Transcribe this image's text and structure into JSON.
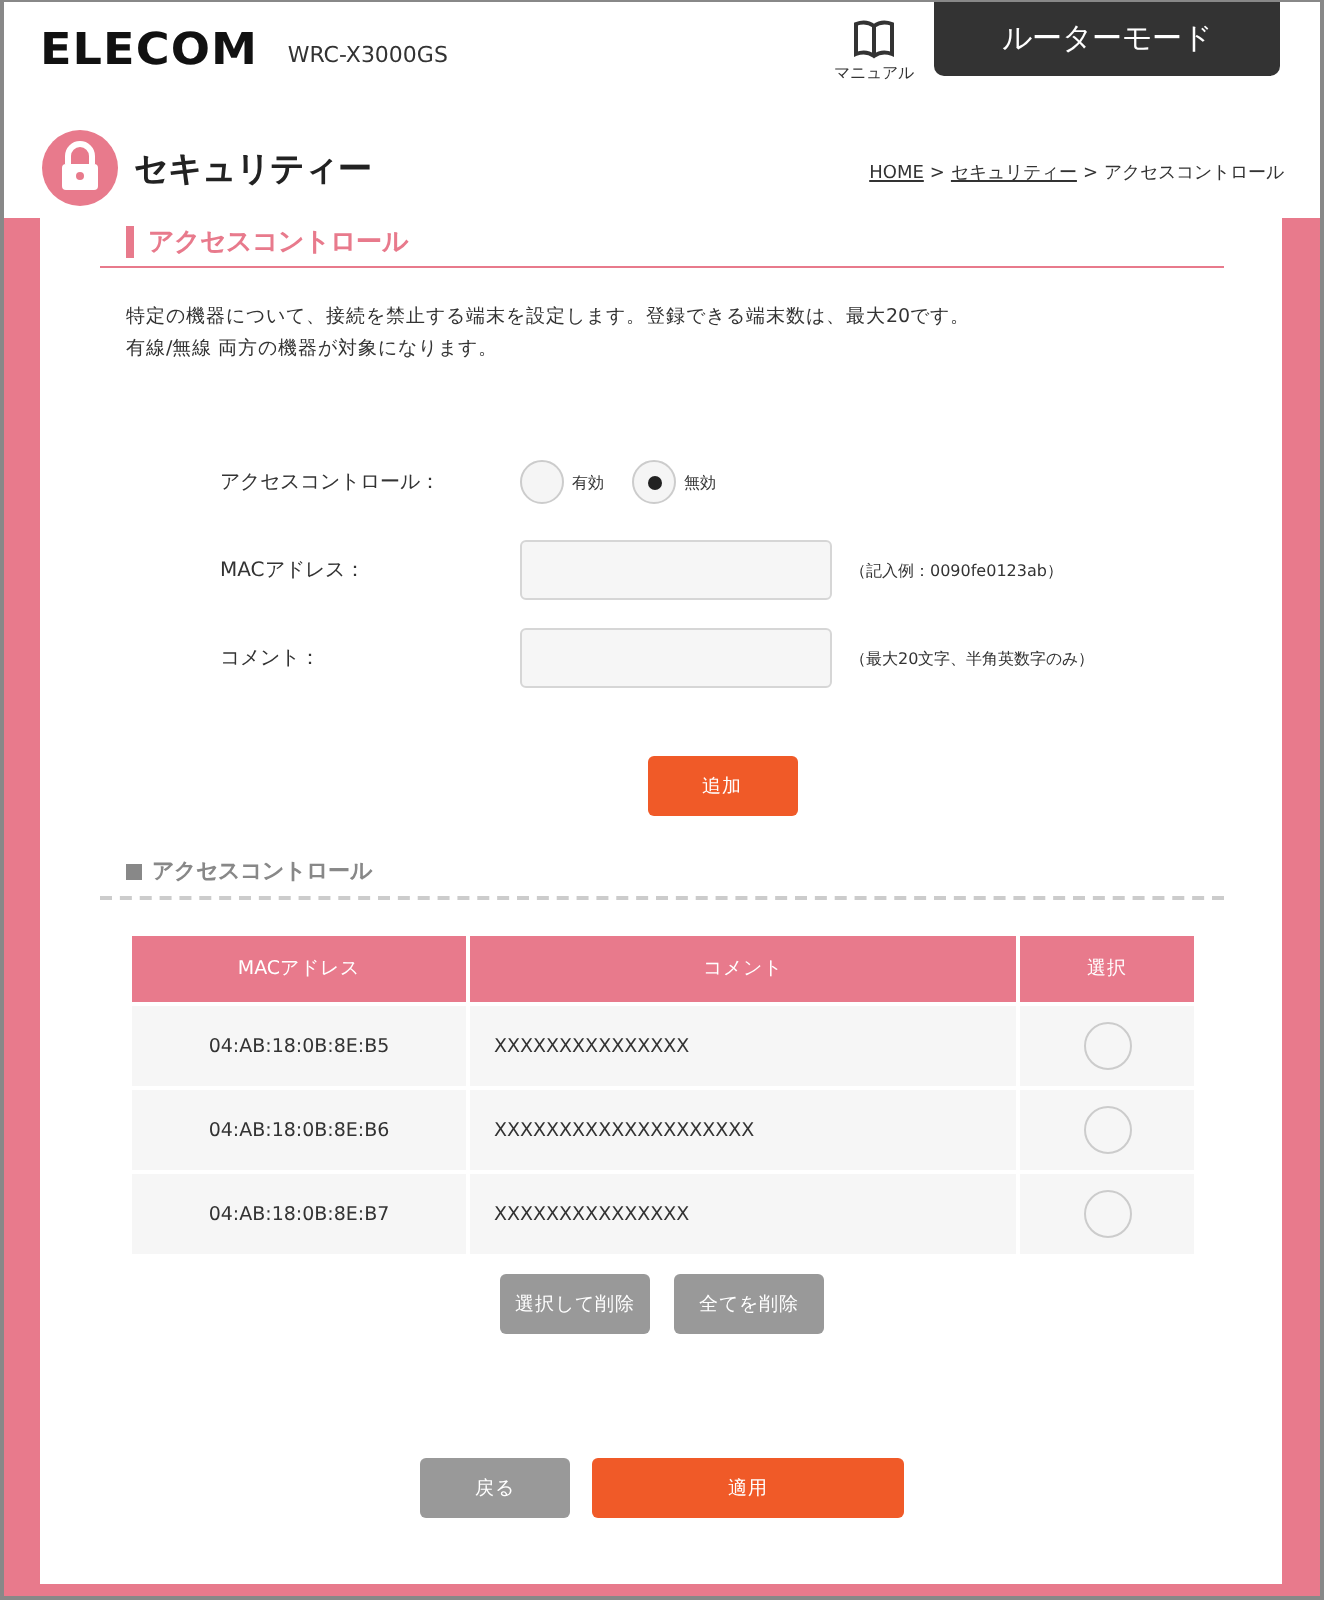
{
  "header": {
    "logo": "ELECOM",
    "model": "WRC-X3000GS",
    "manual": "マニュアル",
    "mode": "ルーターモード"
  },
  "page": {
    "title": "セキュリティー",
    "separator": ">",
    "breadcrumb": [
      {
        "label": "HOME",
        "link": true
      },
      {
        "label": "セキュリティー",
        "link": true
      },
      {
        "label": "アクセスコントロール",
        "link": false
      }
    ]
  },
  "section": {
    "title": "アクセスコントロール",
    "description": [
      "特定の機器について、接続を禁止する端末を設定します。登録できる端末数は、最大20です。",
      "有線/無線 両方の機器が対象になります。"
    ]
  },
  "form": {
    "rows": [
      {
        "kind": "radio",
        "label": "アクセスコントロール：",
        "options": [
          {
            "label": "有効",
            "selected": false
          },
          {
            "label": "無効",
            "selected": true
          }
        ]
      },
      {
        "kind": "text",
        "label": "MACアドレス：",
        "hint": "（記入例：0090fe0123ab）"
      },
      {
        "kind": "text",
        "label": "コメント：",
        "hint": "（最大20文字、半角英数字のみ）"
      }
    ],
    "add_button": "追加"
  },
  "list": {
    "title": "アクセスコントロール",
    "columns": [
      "MACアドレス",
      "コメント",
      "選択"
    ],
    "rows": [
      {
        "mac": "04:AB:18:0B:8E:B5",
        "comment": "XXXXXXXXXXXXXXX",
        "selected": false
      },
      {
        "mac": "04:AB:18:0B:8E:B6",
        "comment": "XXXXXXXXXXXXXXXXXXXX",
        "selected": false
      },
      {
        "mac": "04:AB:18:0B:8E:B7",
        "comment": "XXXXXXXXXXXXXXX",
        "selected": false
      }
    ],
    "buttons": [
      "選択して削除",
      "全てを削除"
    ]
  },
  "footer_buttons": [
    {
      "label": "戻る",
      "kind": "secondary"
    },
    {
      "label": "適用",
      "kind": "primary"
    }
  ]
}
